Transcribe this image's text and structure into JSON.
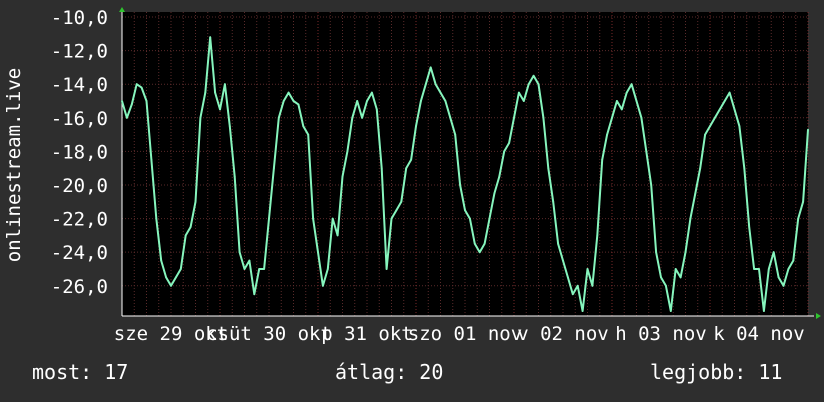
{
  "chart_data": {
    "type": "line",
    "title": "",
    "xlabel": "",
    "ylabel": "onlinestream.live",
    "y_tick_labels": [
      "-10,0",
      "-12,0",
      "-14,0",
      "-16,0",
      "-18,0",
      "-20,0",
      "-22,0",
      "-24,0",
      "-26,0"
    ],
    "y_ticks": [
      -10,
      -12,
      -14,
      -16,
      -18,
      -20,
      -22,
      -24,
      -26
    ],
    "ylim": [
      -27.8,
      -9.7
    ],
    "x_tick_labels": [
      "sze 29 okt",
      "csüt 30 okt",
      "p 31 okt",
      "szo 01 nov",
      "v 02 nov",
      "h 03 nov",
      "k 04 nov"
    ],
    "xlim": [
      0,
      7
    ],
    "grid": true,
    "colors": {
      "background": "#2e2e2e",
      "plot_background": "#000000",
      "grid": "#5a2a2a",
      "line": "#86f5bd",
      "text": "#ffffff",
      "axis_arrow": "#2ec42e"
    },
    "series": [
      {
        "name": "",
        "x": [
          0.0,
          0.05,
          0.1,
          0.15,
          0.2,
          0.25,
          0.3,
          0.35,
          0.4,
          0.45,
          0.5,
          0.55,
          0.6,
          0.65,
          0.7,
          0.75,
          0.8,
          0.85,
          0.9,
          0.95,
          1.0,
          1.05,
          1.1,
          1.15,
          1.2,
          1.25,
          1.3,
          1.35,
          1.4,
          1.45,
          1.5,
          1.55,
          1.6,
          1.65,
          1.7,
          1.75,
          1.8,
          1.85,
          1.9,
          1.95,
          2.0,
          2.05,
          2.1,
          2.15,
          2.2,
          2.25,
          2.3,
          2.35,
          2.4,
          2.45,
          2.5,
          2.55,
          2.6,
          2.65,
          2.7,
          2.75,
          2.8,
          2.85,
          2.9,
          2.95,
          3.0,
          3.05,
          3.1,
          3.15,
          3.2,
          3.25,
          3.3,
          3.35,
          3.4,
          3.45,
          3.5,
          3.55,
          3.6,
          3.65,
          3.7,
          3.75,
          3.8,
          3.85,
          3.9,
          3.95,
          4.0,
          4.05,
          4.1,
          4.15,
          4.2,
          4.25,
          4.3,
          4.35,
          4.4,
          4.45,
          4.5,
          4.55,
          4.6,
          4.65,
          4.7,
          4.75,
          4.8,
          4.85,
          4.9,
          4.95,
          5.0,
          5.05,
          5.1,
          5.15,
          5.2,
          5.25,
          5.3,
          5.35,
          5.4,
          5.45,
          5.5,
          5.55,
          5.6,
          5.65,
          5.7,
          5.75,
          5.8,
          5.85,
          5.9,
          5.95,
          6.0,
          6.05,
          6.1,
          6.15,
          6.2,
          6.25,
          6.3,
          6.35,
          6.4,
          6.45,
          6.5,
          6.55,
          6.6,
          6.65,
          6.7,
          6.75,
          6.8,
          6.85,
          6.9,
          6.95,
          7.0
        ],
        "y": [
          -15.0,
          -16.0,
          -15.2,
          -14.0,
          -14.2,
          -15.0,
          -18.5,
          -22.0,
          -24.5,
          -25.5,
          -26.0,
          -25.5,
          -25.0,
          -23.0,
          -22.5,
          -21.0,
          -16.0,
          -14.5,
          -11.2,
          -14.5,
          -15.5,
          -14.0,
          -16.5,
          -19.5,
          -24.0,
          -25.0,
          -24.5,
          -26.5,
          -25.0,
          -25.0,
          -22.0,
          -19.0,
          -16.0,
          -15.0,
          -14.5,
          -15.0,
          -15.2,
          -16.5,
          -17.0,
          -22.0,
          -24.0,
          -26.0,
          -25.0,
          -22.0,
          -23.0,
          -19.5,
          -18.0,
          -16.0,
          -15.0,
          -16.0,
          -15.0,
          -14.5,
          -15.5,
          -19.0,
          -25.0,
          -22.0,
          -21.5,
          -21.0,
          -19.0,
          -18.5,
          -16.5,
          -15.0,
          -14.0,
          -13.0,
          -14.0,
          -14.5,
          -15.0,
          -16.0,
          -17.0,
          -20.0,
          -21.5,
          -22.0,
          -23.5,
          -24.0,
          -23.5,
          -22.0,
          -20.5,
          -19.5,
          -18.0,
          -17.5,
          -16.0,
          -14.5,
          -15.0,
          -14.0,
          -13.5,
          -14.0,
          -16.0,
          -19.0,
          -21.0,
          -23.5,
          -24.5,
          -25.5,
          -26.5,
          -26.0,
          -27.5,
          -25.0,
          -26.0,
          -23.0,
          -18.5,
          -17.0,
          -16.0,
          -15.0,
          -15.5,
          -14.5,
          -14.0,
          -15.0,
          -16.0,
          -18.0,
          -20.0,
          -24.0,
          -25.5,
          -26.0,
          -27.5,
          -25.0,
          -25.5,
          -24.0,
          -22.0,
          -20.5,
          -19.0,
          -17.0,
          -16.5,
          -16.0,
          -15.5,
          -15.0,
          -14.5,
          -15.5,
          -16.5,
          -19.0,
          -22.5,
          -25.0,
          -25.0,
          -27.5,
          -25.0,
          -24.0,
          -25.5,
          -26.0,
          -25.0,
          -24.5,
          -22.0,
          -21.0,
          -16.7
        ]
      }
    ]
  },
  "stats": {
    "now_label": "most:",
    "now_value": "17",
    "avg_label": "átlag:",
    "avg_value": "20",
    "max_label": "legjobb:",
    "max_value": "11"
  }
}
